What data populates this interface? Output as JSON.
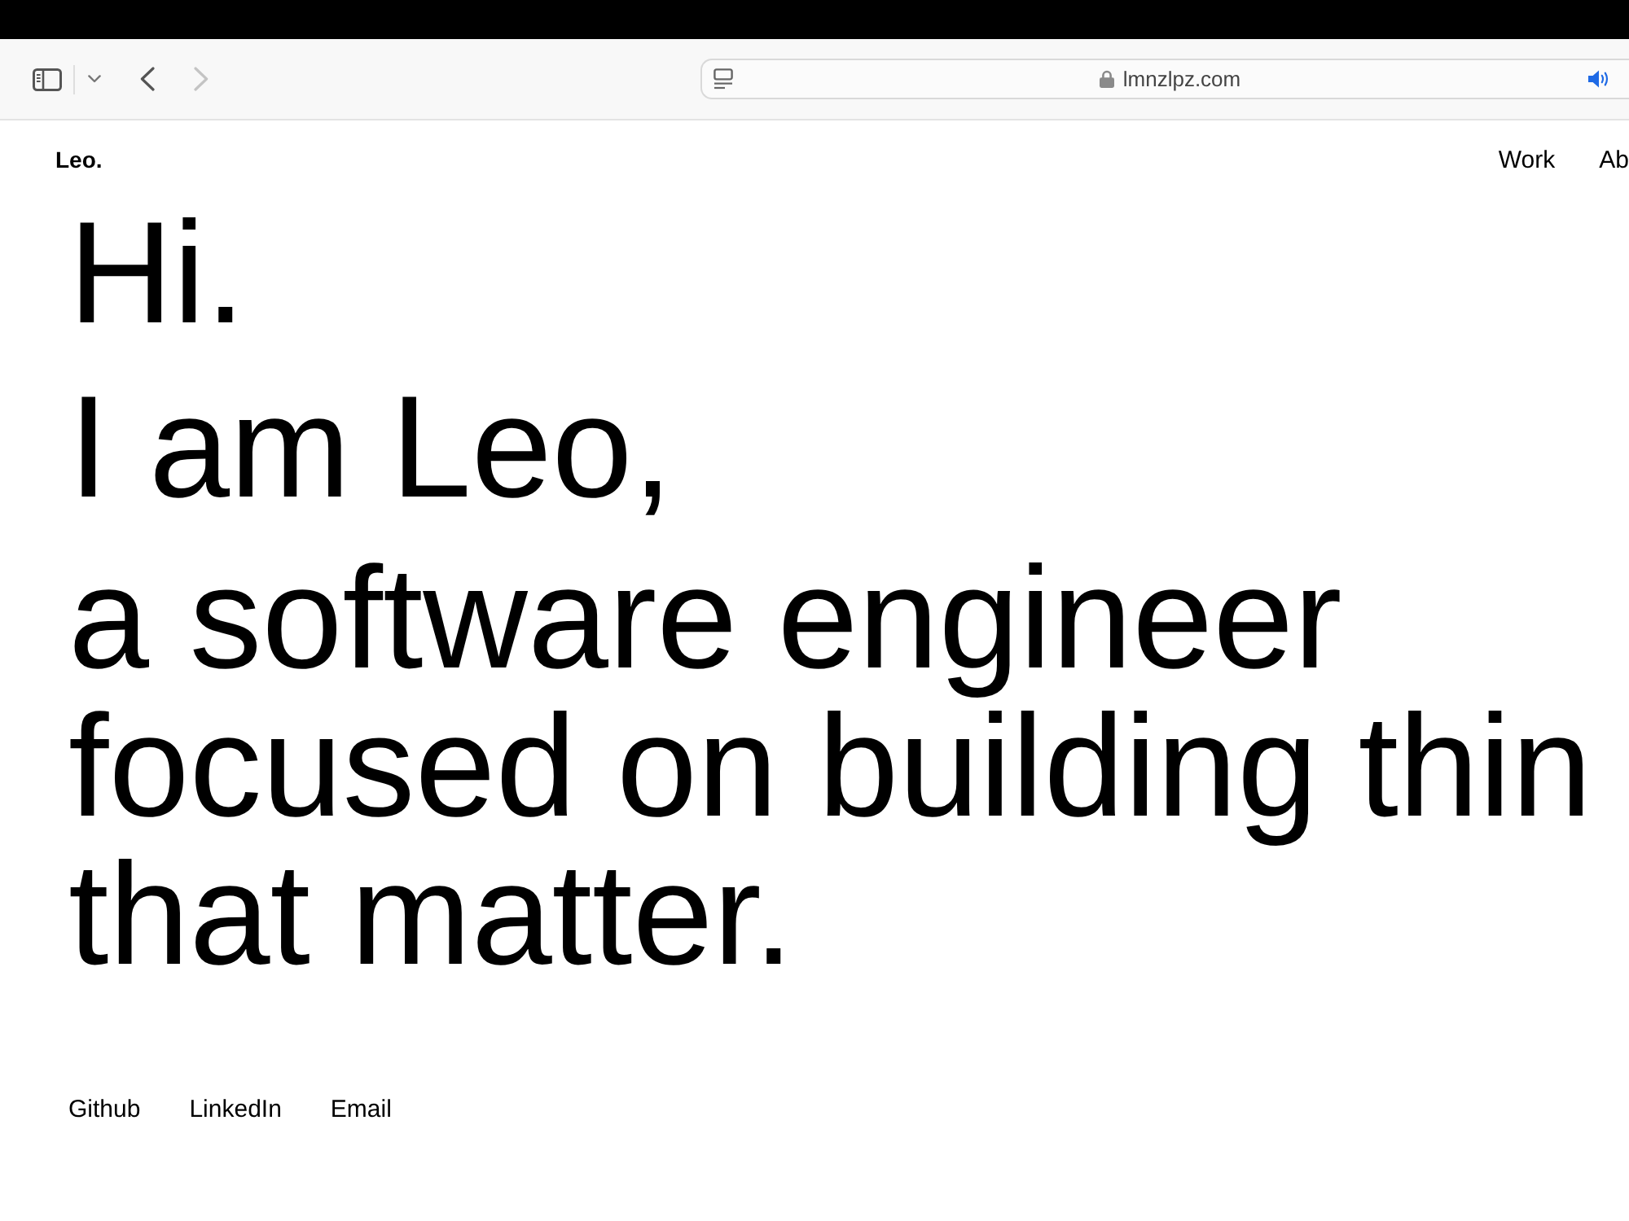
{
  "browser": {
    "nav_buttons": [
      {
        "kind": "back",
        "disabled": false
      },
      {
        "kind": "forward",
        "disabled": true
      }
    ],
    "address_bar": {
      "url": "lmnzlpz.com"
    }
  },
  "header": {
    "logo": "Leo.",
    "nav": [
      {
        "label": "Work"
      },
      {
        "label": "Ab"
      }
    ]
  },
  "hero": {
    "greeting": "Hi.",
    "intro": "I am Leo,",
    "tagline_lines": [
      "a software engineer",
      "focused on building thin",
      "that matter."
    ]
  },
  "links": [
    {
      "label": "Github"
    },
    {
      "label": "LinkedIn"
    },
    {
      "label": "Email"
    }
  ]
}
